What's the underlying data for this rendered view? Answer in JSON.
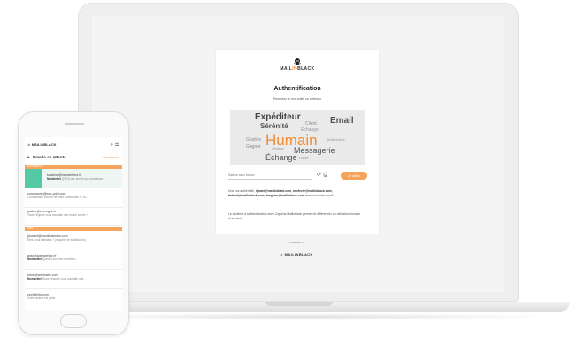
{
  "auth_card": {
    "brand": "MAILINBLACK",
    "title": "Authentification",
    "subtitle": "Recopiez le mot soleil ou entendu",
    "captcha_words": [
      {
        "text": "Expéditeur",
        "color": "#444",
        "size": 10
      },
      {
        "text": "Sérénité",
        "color": "#555",
        "size": 8
      },
      {
        "text": "Client",
        "color": "#888",
        "size": 5
      },
      {
        "text": "Échange",
        "color": "#999",
        "size": 5
      },
      {
        "text": "Email",
        "color": "#555",
        "size": 10
      },
      {
        "text": "Gestion",
        "color": "#888",
        "size": 5
      },
      {
        "text": "Gagner",
        "color": "#888",
        "size": 5
      },
      {
        "text": "Humain",
        "color": "#f28b30",
        "size": 17
      },
      {
        "text": "Mailinblack",
        "color": "#999",
        "size": 4
      },
      {
        "text": "Gestion",
        "color": "#999",
        "size": 4
      },
      {
        "text": "Messagerie",
        "color": "#555",
        "size": 9
      },
      {
        "text": "Échange",
        "color": "#555",
        "size": 9
      },
      {
        "text": "Facile",
        "color": "#999",
        "size": 4
      }
    ],
    "captcha_placeholder": "Saisire avec beaux",
    "refresh_icon": "refresh-icon",
    "audio_icon": "audio-icon",
    "validate_label": "Je valide",
    "paragraph1_prefix": "Une fois authentifié,",
    "paragraph1_emails": "lgirard@mailinblack.com, mlefevre@mailinblack.com, fadrrot@mailinblack.com, dregnier@mailinblack.com",
    "paragraph1_suffix": "recevront votre email.",
    "paragraph2": "Le système d’authentification avec Captcha Mailinblack permet de différencier un utilisateur humain d’un robot.",
    "powered_by": "POWERED BY",
    "footer_brand": "MAILINBLACK"
  },
  "phone": {
    "brand": "MAILINBLACK",
    "section_title": "Emails en attente",
    "select_label": "Sélectionner",
    "divider_today": "AUJOURD'HUI",
    "divider_yesterday": "HIER",
    "emails": [
      {
        "from": "kvachon@newsletters.fr",
        "tag": "Newsletter",
        "snippet": "(DTN) une année qui commence"
      },
      {
        "from": "commande@eau-print.com",
        "tag": "",
        "snippet": "Confirmation d'envoi de votre commande N°30..."
      },
      {
        "from": "justine@zoo-sgvin.fr",
        "tag": "",
        "snippet": "Toute l'équipe vous souhaite une bonne année !"
      },
      {
        "from": "jdurand@mootbusiness.com",
        "tag": "",
        "snippet": "Êtes-vous satisfaits ? (enquête de satisfaction)"
      },
      {
        "from": "anto@agencentop.fr",
        "tag": "Newsletter",
        "snippet": "Quelles sont les nouvelles..."
      },
      {
        "from": "infos@seminaire.com",
        "tag": "Newsletter",
        "snippet": "Toute l'équipe vous souhaite une..."
      },
      {
        "from": "cecf@info.com",
        "tag": "",
        "snippet": "Votre facture est prête"
      }
    ]
  }
}
